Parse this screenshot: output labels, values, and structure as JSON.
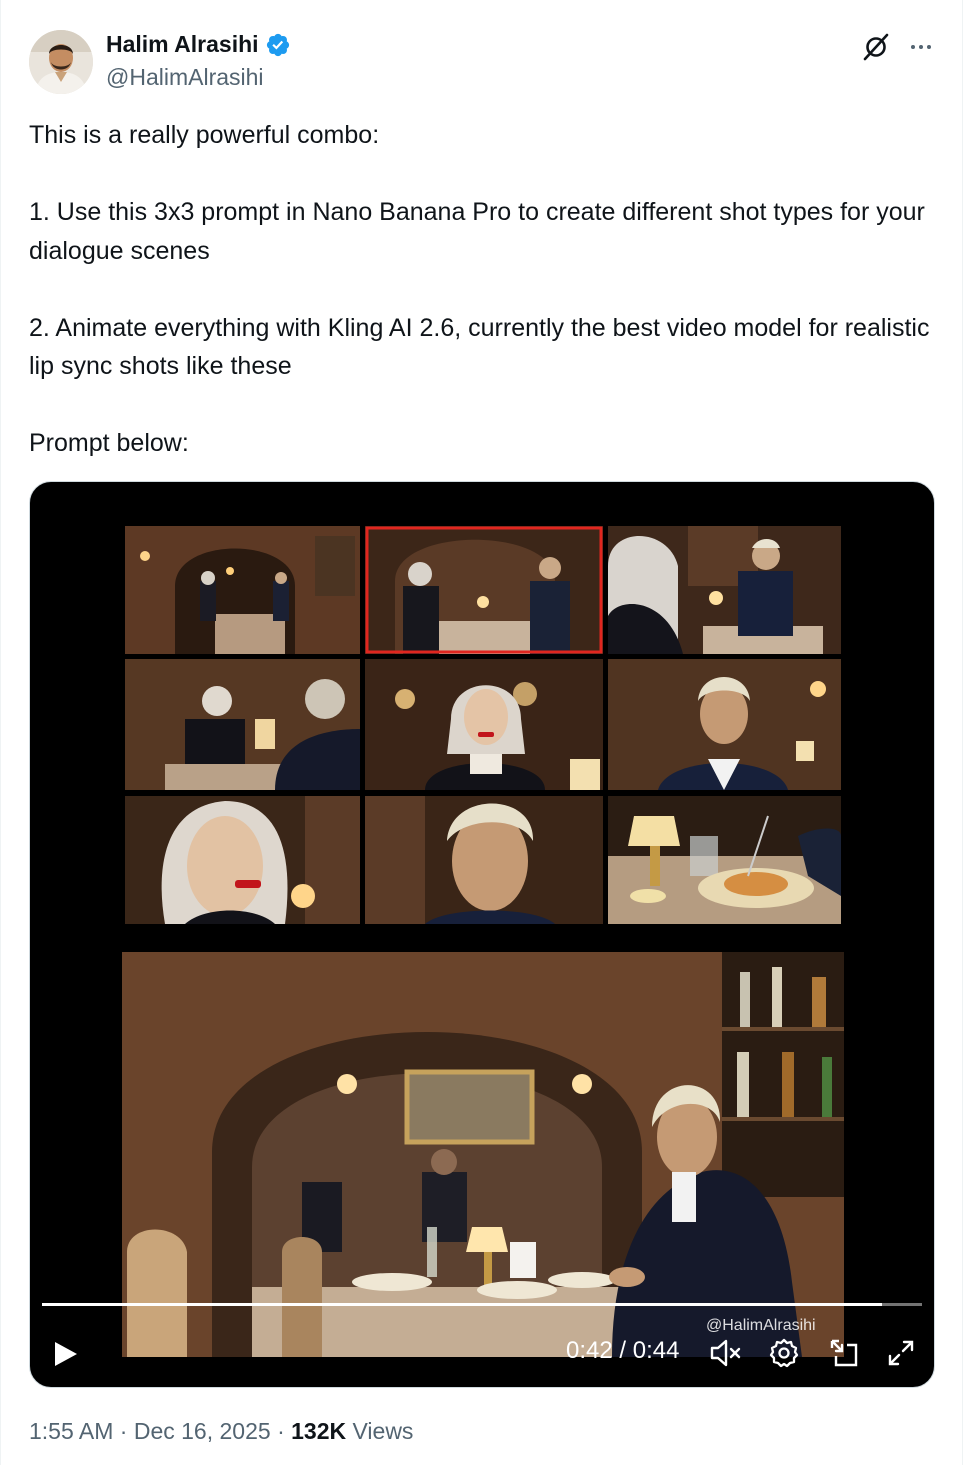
{
  "author": {
    "display_name": "Halim Alrasihi",
    "handle": "@HalimAlrasihi",
    "verified": true,
    "avatar_icon": "person-avatar"
  },
  "header_icons": [
    "grok-icon",
    "more-options-icon"
  ],
  "tweet": {
    "paragraphs": [
      "This is a really powerful combo:",
      "1. Use this 3x3 prompt in Nano Banana Pro to create different shot types for your dialogue scenes",
      "2. Animate everything with Kling AI 2.6, currently the best video model for realistic lip sync shots like these",
      "Prompt below:"
    ]
  },
  "video": {
    "watermark": "@HalimAlrasihi",
    "time_display": "0:42 / 0:44",
    "progress": 0.955,
    "controls": [
      "play-icon",
      "muted-volume-icon",
      "settings-gear-icon",
      "pip-icon",
      "fullscreen-icon"
    ],
    "grid_highlight_cell": 1
  },
  "footer": {
    "time": "1:55 AM",
    "date": "Dec 16, 2025",
    "views_count": "132K",
    "views_label": "Views",
    "separator": "·"
  },
  "colors": {
    "verified_blue": "#1d9bf0",
    "secondary_text": "#536471",
    "primary_text": "#0f1419",
    "highlight_red": "#e0261f"
  }
}
